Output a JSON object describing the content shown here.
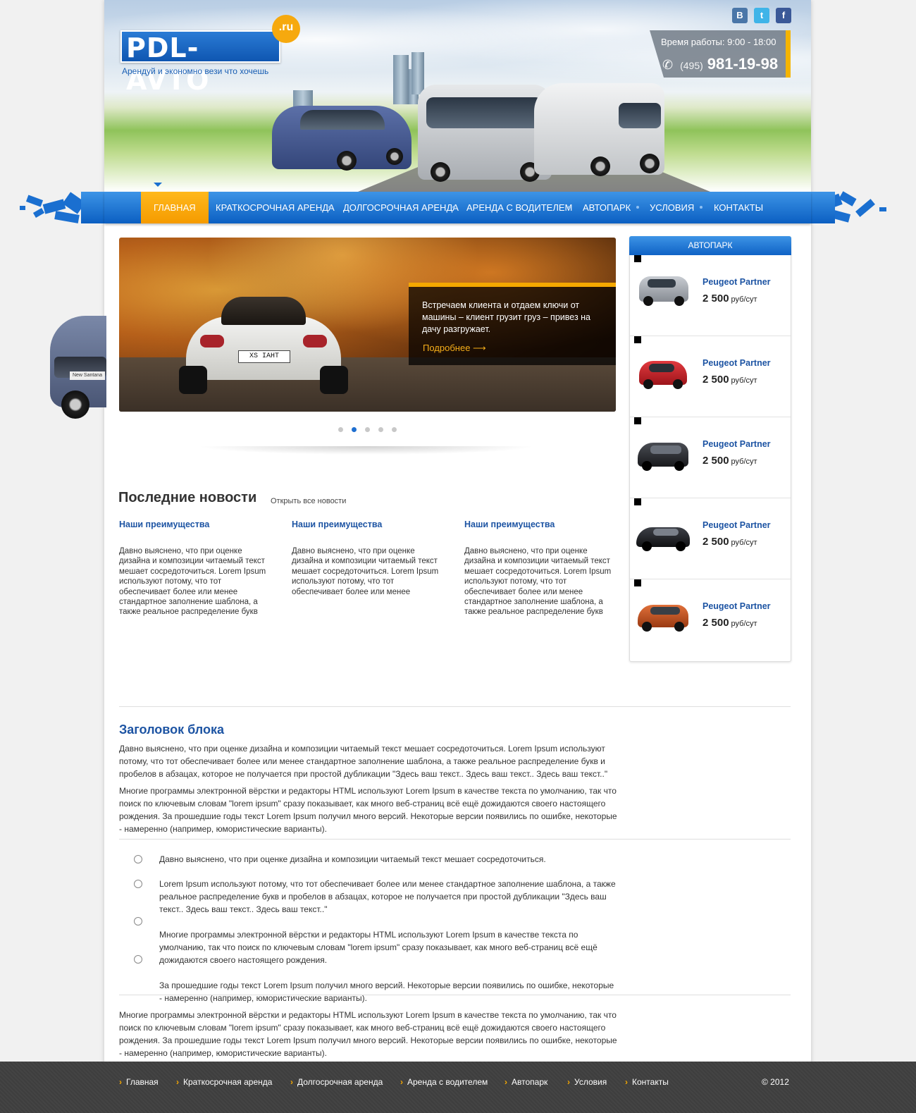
{
  "header": {
    "logo_text": "PDL-AVTO",
    "logo_ru": ".ru",
    "tagline": "Арендуй и экономно вези что хочешь",
    "work_hours": "Время работы: 9:00 - 18:00",
    "phone_code": "(495)",
    "phone_number": "981-19-98",
    "social": [
      {
        "name": "vk",
        "glyph": "В"
      },
      {
        "name": "twitter",
        "glyph": "t"
      },
      {
        "name": "facebook",
        "glyph": "f"
      }
    ]
  },
  "nav": {
    "items": [
      "Главная",
      "Краткосрочная аренда",
      "Долгосрочная аренда",
      "Аренда с водителем",
      "Автопарк",
      "Условия",
      "Контакты"
    ],
    "active_index": 0
  },
  "slider": {
    "caption": "Встречаем клиента и отдаем ключи от машины – клиент грузит груз – привез на дачу разгружает.",
    "more_label": "Подробнее",
    "more_arrow": "⟶",
    "slide_count": 5,
    "active_slide": 1,
    "plate": "XS IAHT"
  },
  "fleet": {
    "title": "Автопарк",
    "items": [
      {
        "name": "Peugeot Partner",
        "price": "2 500",
        "unit": "руб/сут",
        "color": "#9aa0a8"
      },
      {
        "name": "Peugeot Partner",
        "price": "2 500",
        "unit": "руб/сут",
        "color": "#c8202a"
      },
      {
        "name": "Peugeot Partner",
        "price": "2 500",
        "unit": "руб/сут",
        "color": "#2a2c30"
      },
      {
        "name": "Peugeot Partner",
        "price": "2 500",
        "unit": "руб/сут",
        "color": "#1f2226"
      },
      {
        "name": "Peugeot Partner",
        "price": "2 500",
        "unit": "руб/сут",
        "color": "#c4501c"
      }
    ]
  },
  "news": {
    "title": "Последние новости",
    "all_link": "Открыть все новости",
    "items": [
      {
        "heading": "Наши преимущества",
        "text": "Давно выяснено, что при оценке дизайна и композиции читаемый текст мешает сосредоточиться. Lorem Ipsum используют потому, что тот обеспечивает более или менее стандартное заполнение шаблона, а также реальное распределение букв"
      },
      {
        "heading": "Наши преимущества",
        "text": "Давно выяснено, что при оценке дизайна и композиции читаемый текст мешает сосредоточиться. Lorem Ipsum используют потому, что тот обеспечивает более или менее"
      },
      {
        "heading": "Наши преимущества",
        "text": "Давно выяснено, что при оценке дизайна и композиции читаемый текст мешает сосредоточиться. Lorem Ipsum используют потому, что тот обеспечивает более или менее стандартное заполнение шаблона, а также реальное распределение букв"
      }
    ]
  },
  "block": {
    "title": "Заголовок блока",
    "para1": "Давно выяснено, что при оценке дизайна и композиции читаемый текст мешает сосредоточиться. Lorem Ipsum используют потому, что тот обеспечивает более или менее стандартное заполнение шаблона, а также реальное распределение букв и пробелов в абзацах, которое не получается при простой дубликации \"Здесь ваш текст.. Здесь ваш текст.. Здесь ваш текст..\"",
    "para2": "Многие программы электронной вёрстки и редакторы HTML используют Lorem Ipsum в качестве текста по умолчанию, так что поиск по ключевым словам \"lorem ipsum\" сразу показывает, как много веб-страниц всё ещё дожидаются своего настоящего рождения. За прошедшие годы текст Lorem Ipsum получил много версий. Некоторые версии появились по ошибке, некоторые - намеренно (например, юмористические варианты).",
    "list": [
      "Давно выяснено, что при оценке дизайна и композиции читаемый текст мешает сосредоточиться.",
      "Lorem Ipsum используют потому, что тот обеспечивает более или менее стандартное заполнение шаблона, а также реальное распределение букв и пробелов в абзацах, которое не получается при простой дубликации \"Здесь ваш текст.. Здесь ваш текст.. Здесь ваш текст..\"",
      "Многие программы электронной вёрстки и редакторы HTML используют Lorem Ipsum в качестве текста по умолчанию, так что поиск по ключевым словам \"lorem ipsum\" сразу показывает, как много веб-страниц всё ещё дожидаются своего настоящего рождения.",
      "За прошедшие годы текст Lorem Ipsum получил много версий. Некоторые версии появились по ошибке, некоторые - намеренно (например, юмористические варианты)."
    ],
    "para3": "Многие программы электронной вёрстки и редакторы HTML используют Lorem Ipsum в качестве текста по умолчанию, так что поиск по ключевым словам \"lorem ipsum\" сразу показывает, как много веб-страниц всё ещё дожидаются своего настоящего рождения. За прошедшие годы текст Lorem Ipsum получил много версий. Некоторые версии появились по ошибке, некоторые - намеренно (например, юмористические варианты)."
  },
  "footer": {
    "links": [
      "Главная",
      "Краткосрочная аренда",
      "Долгосрочная аренда",
      "Аренда с водителем",
      "Автопарк",
      "Условия",
      "Контакты"
    ],
    "chevron": "›",
    "copyright": "© 2012"
  },
  "colors": {
    "brand_blue": "#0f62c5",
    "accent_orange": "#f5a800",
    "link_blue": "#1d54a3"
  },
  "side_car_badge": "New Santana"
}
